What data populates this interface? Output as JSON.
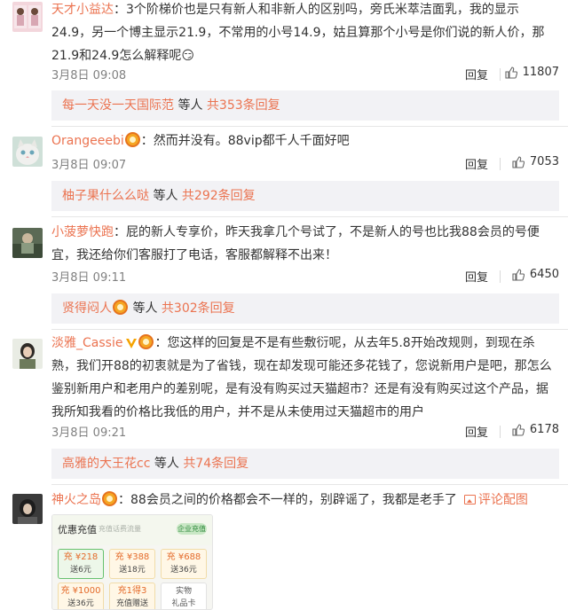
{
  "comments": [
    {
      "user": "天才小益达",
      "colon": "：",
      "text": "3个阶梯价也是只有新人和非新人的区别吗，旁氏米萃洁面乳，我的显示24.9，另一个博主显示21.9，不常用的小号14.9，姑且算那个小号是你们说的新人价，那21.9和24.9怎么解释呢",
      "emoji": "😏",
      "time": "3月8日 09:08",
      "reply_label": "回复",
      "likes": "11807",
      "replies_user": "每一天没一天国际范",
      "replies_middle": " 等人 ",
      "replies_count": "共353条回复"
    },
    {
      "user": "Orangeeebi",
      "colon": "：",
      "text": "然而并没有。88vip都千人千面好吧",
      "time": "3月8日 09:07",
      "reply_label": "回复",
      "likes": "7053",
      "replies_user": "柚子果什么么哒",
      "replies_middle": " 等人 ",
      "replies_count": "共292条回复"
    },
    {
      "user": "小菠萝快跑",
      "colon": "：",
      "text": "屁的新人专享价，昨天我拿几个号试了，不是新人的号也比我88会员的号便宜，我还给你们客服打了电话，客服都解释不出来！",
      "time": "3月8日 09:11",
      "reply_label": "回复",
      "likes": "6450",
      "replies_user": "贤得闷人",
      "replies_middle": " 等人 ",
      "replies_count": "共302条回复"
    },
    {
      "user": "淡雅_Cassie",
      "colon": "：",
      "text": "您这样的回复是不是有些敷衍呢，从去年5.8开始改规则，到现在杀熟，我们开88的初衷就是为了省钱，现在却发现可能还多花钱了，您说新用户是吧，那怎么鉴别新用户和老用户的差别呢，是有没有购买过天猫超市？还是有没有购买过这个产品，据我所知我看的价格比我低的用户，并不是从未使用过天猫超市的用户",
      "time": "3月8日 09:21",
      "reply_label": "回复",
      "likes": "6178",
      "replies_user": "高雅的大王花cc",
      "replies_middle": " 等人 ",
      "replies_count": "共74条回复"
    },
    {
      "user": "神火之岛",
      "colon": "：",
      "text": "88会员之间的价格都会不一样的，别辟谣了，我都是老手了",
      "pic_label": "评论配图"
    }
  ],
  "embed": {
    "title": "优惠充值",
    "subtitle": "充值话费流量",
    "tag": "企业充值",
    "tiles": [
      {
        "top": "充 ¥218",
        "bottom": "送6元"
      },
      {
        "top": "充 ¥388",
        "bottom": "送18元"
      },
      {
        "top": "充 ¥688",
        "bottom": "送36元"
      },
      {
        "top": "充 ¥1000",
        "bottom": "送36元"
      },
      {
        "top": "充1得3",
        "bottom": "充值赠送"
      },
      {
        "top": "实物",
        "bottom": "礼品卡"
      }
    ]
  },
  "colors": {
    "link": "#eb7350",
    "text": "#333333",
    "meta": "#808080",
    "reply_bar": "#f2f2f5"
  }
}
